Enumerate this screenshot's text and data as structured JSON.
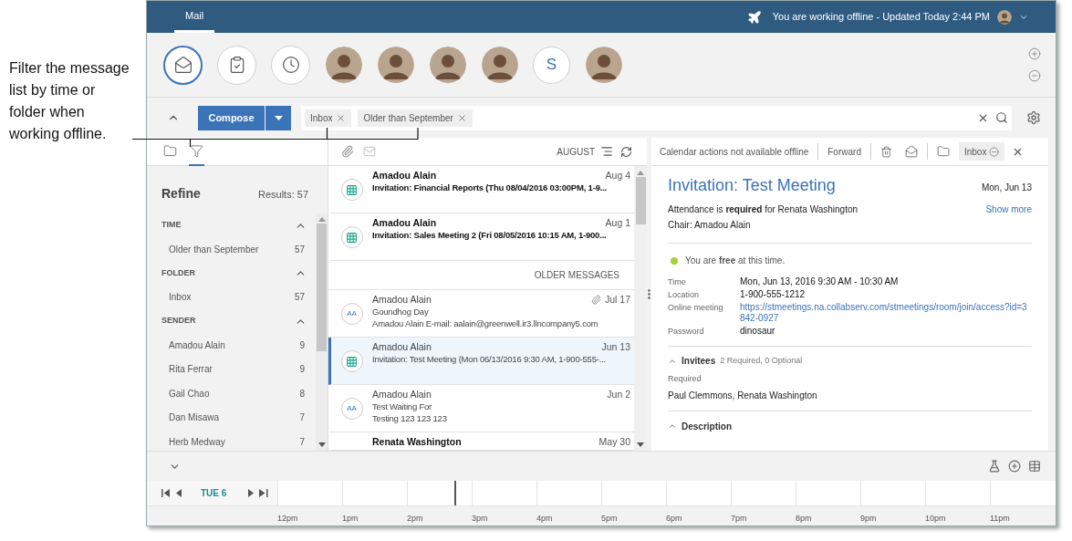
{
  "callout": {
    "text": "Filter the message list by time or folder when working offline."
  },
  "top_bar": {
    "tabs": [
      {
        "label": "Mail",
        "selected": true
      }
    ],
    "status": "You are working offline - Updated Today 2:44 PM"
  },
  "shortcuts": [
    {
      "kind": "mail",
      "selected": true
    },
    {
      "kind": "tasks",
      "selected": false
    },
    {
      "kind": "calendar",
      "selected": false
    },
    {
      "kind": "person",
      "selected": false
    },
    {
      "kind": "person",
      "selected": false
    },
    {
      "kind": "person",
      "selected": false
    },
    {
      "kind": "person",
      "selected": false
    },
    {
      "kind": "initial",
      "label": "S",
      "selected": false
    },
    {
      "kind": "person",
      "selected": false
    }
  ],
  "toolbar": {
    "compose": "Compose",
    "filters": [
      {
        "label": "Inbox"
      },
      {
        "label": "Older than September"
      }
    ]
  },
  "side_tabs": [
    {
      "kind": "folder",
      "selected": false
    },
    {
      "kind": "filter",
      "selected": true
    }
  ],
  "refine": {
    "title": "Refine",
    "results": "Results: 57",
    "sections": [
      {
        "title": "TIME",
        "expanded": true,
        "items": [
          {
            "label": "Older than September",
            "count": "57"
          }
        ]
      },
      {
        "title": "FOLDER",
        "expanded": true,
        "items": [
          {
            "label": "Inbox",
            "count": "57"
          }
        ]
      },
      {
        "title": "SENDER",
        "expanded": true,
        "items": [
          {
            "label": "Amadou Alain",
            "count": "9"
          },
          {
            "label": "Rita Ferrar",
            "count": "9"
          },
          {
            "label": "Gail Chao",
            "count": "8"
          },
          {
            "label": "Dan Misawa",
            "count": "7"
          },
          {
            "label": "Herb Medway",
            "count": "7"
          }
        ]
      }
    ]
  },
  "list_header": {
    "month": "AUGUST"
  },
  "messages": [
    {
      "kind": "message",
      "sender": "Amadou Alain",
      "date": "Aug 4",
      "lines": [
        "Invitation: Financial Reports (Thu 08/04/2016 03:00PM, 1-9..."
      ],
      "unread": true,
      "attachment": false,
      "selected": false
    },
    {
      "kind": "message",
      "sender": "Amadou Alain",
      "date": "Aug 1",
      "lines": [
        "Invitation: Sales Meeting 2 (Fri 08/05/2016 10:15 AM, 1-900..."
      ],
      "unread": true,
      "attachment": false,
      "selected": false
    },
    {
      "kind": "divider",
      "label": "OLDER MESSAGES"
    },
    {
      "kind": "message",
      "initials": "AA",
      "sender": "Amadou Alain",
      "date": "Jul 17",
      "lines": [
        "Goundhog Day",
        "Amadou Alain E-mail: aalain@greenwell.ir3.llncompany5.com"
      ],
      "unread": false,
      "attachment": true,
      "selected": false
    },
    {
      "kind": "message",
      "sender": "Amadou Alain",
      "date": "Jun 13",
      "lines": [
        "Invitation: Test Meeting (Mon 06/13/2016 9:30 AM, 1-900-555-..."
      ],
      "unread": false,
      "attachment": false,
      "selected": true
    },
    {
      "kind": "message",
      "initials": "AA",
      "sender": "Amadou Alain",
      "date": "Jun 2",
      "lines": [
        "Test Waiting For",
        "Testing 123 123 123"
      ],
      "unread": false,
      "attachment": false,
      "selected": false
    },
    {
      "kind": "partial",
      "sender": "Renata Washington",
      "date": "May 30",
      "unread": true,
      "attachment": false,
      "selected": false
    }
  ],
  "reader": {
    "notice": "Calendar actions not available offline",
    "forward": "Forward",
    "folder_tag": "Inbox",
    "title": "Invitation: Test Meeting",
    "date": "Mon, Jun 13",
    "attendance": "Attendance is **required** for Renata Washington",
    "chair": "Chair: Amadou Alain",
    "show_more": "Show more",
    "availability": {
      "text": "You are **free** at this time."
    },
    "details": [
      {
        "label": "Time",
        "value": "Mon, Jun 13, 2016 9:30 AM - 10:30 AM",
        "kind": "text"
      },
      {
        "label": "Location",
        "value": "1-900-555-1212",
        "kind": "text"
      },
      {
        "label": "Online meeting",
        "value": "https://stmeetings.na.collabserv.com/stmeetings/room/join/access?id=3842-0927",
        "kind": "link"
      },
      {
        "label": "Password",
        "value": "dinosaur",
        "kind": "text"
      }
    ],
    "invitees": {
      "title": "Invitees",
      "summary": "2 Required, 0 Optional",
      "expanded": true,
      "group": "Required",
      "names": "Paul Clemmons, Renata Washington"
    },
    "description": {
      "title": "Description",
      "expanded": true
    }
  },
  "timeline": {
    "day": "TUE 6",
    "hours": [
      "12pm",
      "1pm",
      "2pm",
      "3pm",
      "4pm",
      "5pm",
      "6pm",
      "7pm",
      "8pm",
      "9pm",
      "10pm",
      "11pm"
    ]
  }
}
